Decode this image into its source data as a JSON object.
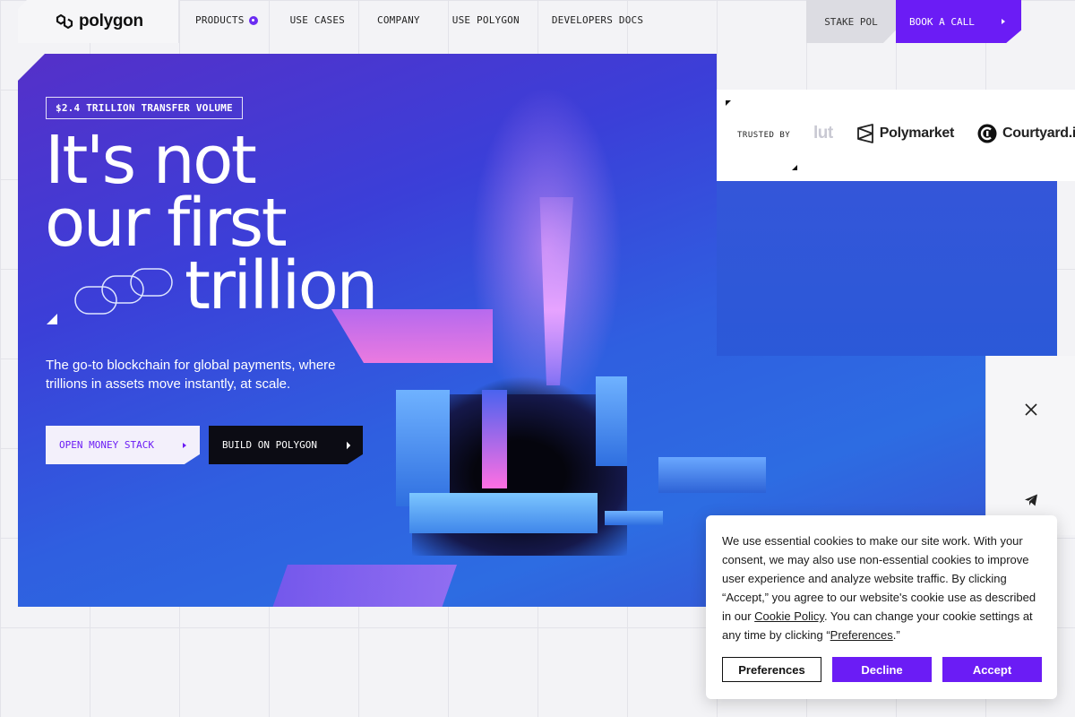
{
  "nav": {
    "logo_text": "polygon",
    "items": [
      {
        "label": "PRODUCTS"
      },
      {
        "label": "USE CASES"
      },
      {
        "label": "COMPANY"
      },
      {
        "label": "USE POLYGON"
      },
      {
        "label": "DEVELOPERS DOCS"
      }
    ],
    "stake_label": "STAKE POL",
    "book_label": "BOOK A CALL"
  },
  "hero": {
    "badge": "$2.4 TRILLION TRANSFER VOLUME",
    "headline": {
      "line1": "It's not",
      "line2": "our first",
      "line3": "trillion"
    },
    "subtitle": "The go-to blockchain for global payments, where trillions in assets move instantly, at scale.",
    "cta_primary": "OPEN MONEY STACK",
    "cta_secondary": "BUILD ON POLYGON"
  },
  "trusted": {
    "label": "TRUSTED BY",
    "logos": [
      {
        "name": "lut",
        "icon": "revolut-partial"
      },
      {
        "name": "Polymarket",
        "icon": "polymarket-icon"
      },
      {
        "name": "Courtyard.io",
        "icon": "courtyard-icon"
      }
    ]
  },
  "social": {
    "icons": [
      "x-icon",
      "telegram-icon"
    ]
  },
  "cookie": {
    "text_1": "We use essential cookies to make our site work. With your consent, we may also use non-essential cookies to improve user experience and analyze website traffic. By clicking “Accept,” you agree to our website's cookie use as described in our ",
    "link_policy": "Cookie Policy",
    "text_2": ". You can change your cookie settings at any time by clicking “",
    "link_prefs": "Preferences",
    "text_3": ".”",
    "btn_preferences": "Preferences",
    "btn_decline": "Decline",
    "btn_accept": "Accept"
  },
  "colors": {
    "brand_purple": "#6b1cf5",
    "hero_blue": "#2f5fe0",
    "background": "#f3f3f6"
  }
}
